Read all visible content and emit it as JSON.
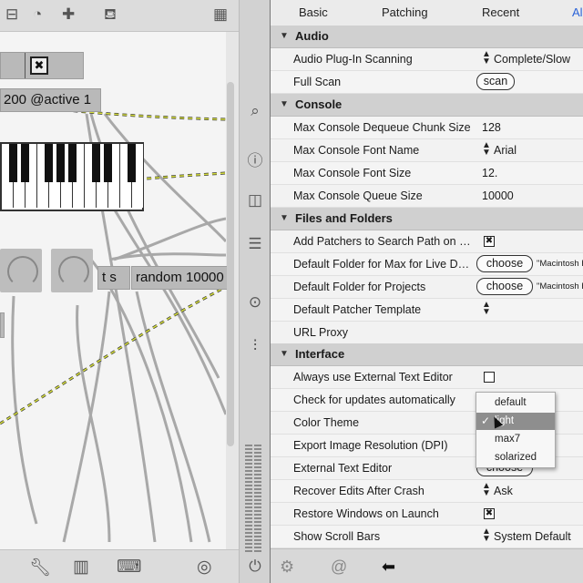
{
  "patcher": {
    "objects": {
      "metro": "200 @active 1",
      "trigger": "t s",
      "random": "random 10000"
    },
    "toolbar_icons": [
      "minus-box-icon",
      "gauge-icon",
      "plus-icon",
      "paint-bucket-icon",
      "grid-icon"
    ],
    "bottom_icons": [
      "wrench-icon",
      "piano-icon",
      "keyboard-icon",
      "target-icon"
    ]
  },
  "strip_icons": [
    "search-icon",
    "info-icon",
    "columns-icon",
    "list-icon",
    "camera-icon",
    "sliders-icon",
    "power-icon"
  ],
  "prefs": {
    "tabs": [
      "Basic",
      "Patching",
      "Recent",
      "Al"
    ],
    "sections": {
      "audio": "Audio",
      "console": "Console",
      "files": "Files and Folders",
      "interface": "Interface"
    },
    "rows": {
      "audio_plugin_scanning": {
        "name": "Audio Plug-In Scanning",
        "value": "Complete/Slow"
      },
      "full_scan": {
        "name": "Full Scan",
        "button": "scan"
      },
      "dequeue_chunk": {
        "name": "Max Console Dequeue Chunk Size",
        "value": "128"
      },
      "console_font_name": {
        "name": "Max Console Font Name",
        "value": "Arial"
      },
      "console_font_size": {
        "name": "Max Console Font Size",
        "value": "12."
      },
      "console_queue_size": {
        "name": "Max Console Queue Size",
        "value": "10000"
      },
      "add_patchers": {
        "name": "Add Patchers to Search Path on Save",
        "checked": "✖"
      },
      "default_folder_live": {
        "name": "Default Folder for Max for Live Devi...",
        "button": "choose",
        "path": "\"Macintosh H"
      },
      "default_folder_projects": {
        "name": "Default Folder for Projects",
        "button": "choose",
        "path": "\"Macintosh H"
      },
      "default_template": {
        "name": "Default Patcher Template"
      },
      "url_proxy": {
        "name": "URL Proxy"
      },
      "external_editor_always": {
        "name": "Always use External Text Editor"
      },
      "check_updates": {
        "name": "Check for updates automatically"
      },
      "color_theme": {
        "name": "Color Theme"
      },
      "export_resolution": {
        "name": "Export Image Resolution (DPI)"
      },
      "external_editor": {
        "name": "External Text Editor",
        "button": "choose"
      },
      "recover_edits": {
        "name": "Recover Edits After Crash",
        "value": "Ask"
      },
      "restore_windows": {
        "name": "Restore Windows on Launch",
        "checked": "✖"
      },
      "scroll_bars": {
        "name": "Show Scroll Bars",
        "value": "System Default"
      }
    },
    "theme_menu": {
      "options": [
        "default",
        "light",
        "max7",
        "solarized"
      ],
      "selected": "light",
      "check": "✓"
    },
    "bottom_icons": [
      "gear-icon",
      "at-sign-icon",
      "back-arrow-icon"
    ]
  }
}
